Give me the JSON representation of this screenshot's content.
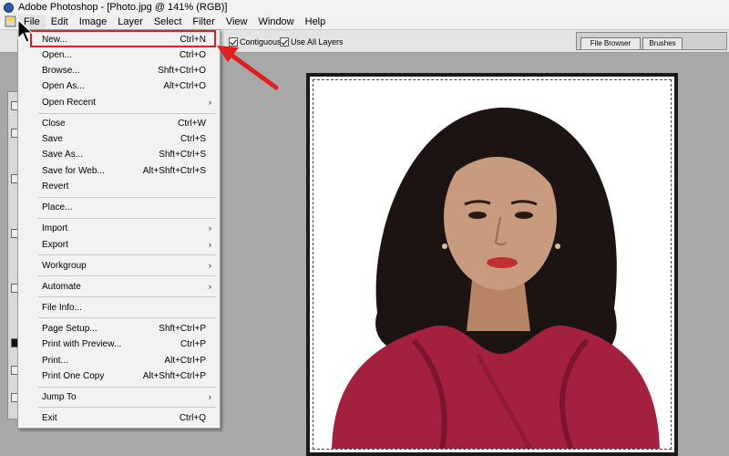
{
  "window": {
    "title": "Adobe Photoshop - [Photo.jpg @ 141% (RGB)]",
    "icon": "photoshop-app-icon"
  },
  "menubar": {
    "items": [
      {
        "label": "File",
        "active": true
      },
      {
        "label": "Edit"
      },
      {
        "label": "Image"
      },
      {
        "label": "Layer"
      },
      {
        "label": "Select"
      },
      {
        "label": "Filter"
      },
      {
        "label": "View"
      },
      {
        "label": "Window"
      },
      {
        "label": "Help"
      }
    ]
  },
  "options": {
    "contiguous_label": "Contiguous",
    "contiguous_checked": true,
    "use_all_layers_label": "Use All Layers",
    "use_all_layers_checked": true
  },
  "palette_well": {
    "tabs": [
      "File Browser",
      "Brushes"
    ]
  },
  "file_menu": {
    "items": [
      {
        "label": "New...",
        "shortcut": "Ctrl+N",
        "highlighted": true
      },
      {
        "label": "Open...",
        "shortcut": "Ctrl+O"
      },
      {
        "label": "Browse...",
        "shortcut": "Shft+Ctrl+O"
      },
      {
        "label": "Open As...",
        "shortcut": "Alt+Ctrl+O"
      },
      {
        "label": "Open Recent",
        "submenu": true
      },
      {
        "label": "Close",
        "shortcut": "Ctrl+W"
      },
      {
        "label": "Save",
        "shortcut": "Ctrl+S"
      },
      {
        "label": "Save As...",
        "shortcut": "Shft+Ctrl+S"
      },
      {
        "label": "Save for Web...",
        "shortcut": "Alt+Shft+Ctrl+S"
      },
      {
        "label": "Revert"
      },
      {
        "label": "Place..."
      },
      {
        "label": "Import",
        "submenu": true
      },
      {
        "label": "Export",
        "submenu": true
      },
      {
        "label": "Workgroup",
        "submenu": true
      },
      {
        "label": "Automate",
        "submenu": true
      },
      {
        "label": "File Info..."
      },
      {
        "label": "Page Setup...",
        "shortcut": "Shft+Ctrl+P"
      },
      {
        "label": "Print with Preview...",
        "shortcut": "Ctrl+P"
      },
      {
        "label": "Print...",
        "shortcut": "Alt+Ctrl+P"
      },
      {
        "label": "Print One Copy",
        "shortcut": "Alt+Shft+Ctrl+P"
      },
      {
        "label": "Jump To",
        "submenu": true
      },
      {
        "label": "Exit",
        "shortcut": "Ctrl+Q"
      }
    ]
  },
  "colors": {
    "annotation": "#e02020",
    "menu_bg": "#f2f2f2",
    "workspace": "#a8a8a8",
    "shirt": "#a3203f",
    "hair": "#1c1412",
    "skin": "#c89a7e"
  }
}
